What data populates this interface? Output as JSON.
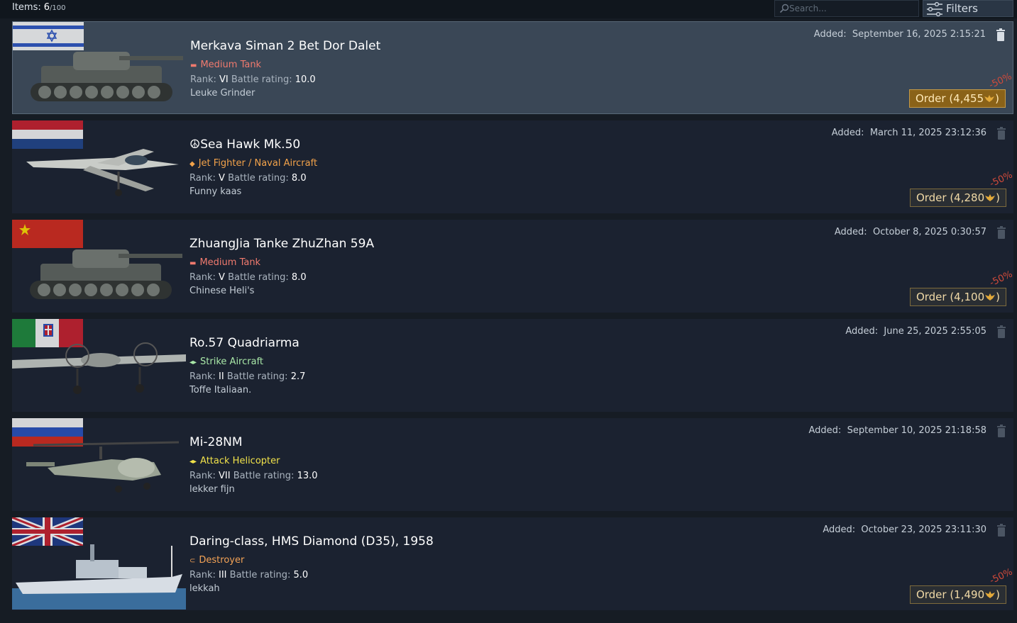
{
  "header": {
    "items_label": "Items:",
    "items_count": "6",
    "items_max": "/100",
    "search_placeholder": "Search...",
    "filters_label": "Filters"
  },
  "items": [
    {
      "name": "Merkava Siman 2 Bet Dor Dalet",
      "type_icon": "medium-tank-icon",
      "type_label": "Medium Tank",
      "type_color": "#f07a6e",
      "rank_label": "Rank:",
      "rank": "VI",
      "br_label": "Battle rating:",
      "br": "10.0",
      "note": "Leuke Grinder",
      "added_label": "Added:",
      "added": "September 16, 2025 2:15:21",
      "order_label": "Order (4,455",
      "order_suffix": ")",
      "discount": "-50%",
      "flag": "israel"
    },
    {
      "name": "☮Sea Hawk Mk.50",
      "type_icon": "jet-fighter-icon",
      "type_label": "Jet Fighter / Naval Aircraft",
      "type_color": "#f2a24a",
      "rank_label": "Rank:",
      "rank": "V",
      "br_label": "Battle rating:",
      "br": "8.0",
      "note": "Funny kaas",
      "added_label": "Added:",
      "added": "March 11, 2025 23:12:36",
      "order_label": "Order (4,280",
      "order_suffix": ")",
      "discount": "-50%",
      "flag": "netherlands"
    },
    {
      "name": "ZhuangJia Tanke ZhuZhan 59A",
      "type_icon": "medium-tank-icon",
      "type_label": "Medium Tank",
      "type_color": "#f07a6e",
      "rank_label": "Rank:",
      "rank": "V",
      "br_label": "Battle rating:",
      "br": "8.0",
      "note": "Chinese Heli's",
      "added_label": "Added:",
      "added": "October 8, 2025 0:30:57",
      "order_label": "Order (4,100",
      "order_suffix": ")",
      "discount": "-50%",
      "flag": "china"
    },
    {
      "name": "Ro.57 Quadriarma",
      "type_icon": "strike-aircraft-icon",
      "type_label": "Strike Aircraft",
      "type_color": "#a9e8a8",
      "rank_label": "Rank:",
      "rank": "II",
      "br_label": "Battle rating:",
      "br": "2.7",
      "note": "Toffe Italiaan.",
      "added_label": "Added:",
      "added": "June 25, 2025 2:55:05",
      "order_label": "",
      "order_suffix": "",
      "discount": "",
      "flag": "italy"
    },
    {
      "name": "Mi-28NM",
      "type_icon": "attack-helicopter-icon",
      "type_label": "Attack Helicopter",
      "type_color": "#f1e24a",
      "rank_label": "Rank:",
      "rank": "VII",
      "br_label": "Battle rating:",
      "br": "13.0",
      "note": "lekker fijn",
      "added_label": "Added:",
      "added": "September 10, 2025 21:18:58",
      "order_label": "",
      "order_suffix": "",
      "discount": "",
      "flag": "russia"
    },
    {
      "name": "Daring-class, HMS Diamond (D35), 1958",
      "type_icon": "destroyer-icon",
      "type_label": "Destroyer",
      "type_color": "#f4a356",
      "rank_label": "Rank:",
      "rank": "III",
      "br_label": "Battle rating:",
      "br": "5.0",
      "note": "lekkah",
      "added_label": "Added:",
      "added": "October 23, 2025 23:11:30",
      "order_label": "Order (1,490",
      "order_suffix": ")",
      "discount": "-50%",
      "flag": "uk"
    }
  ],
  "colors": {
    "background": "#161c24",
    "row": "#1b2230",
    "row_selected": "#3a4756",
    "order_gold": "#8a6218",
    "discount_red": "#d04a3a"
  }
}
